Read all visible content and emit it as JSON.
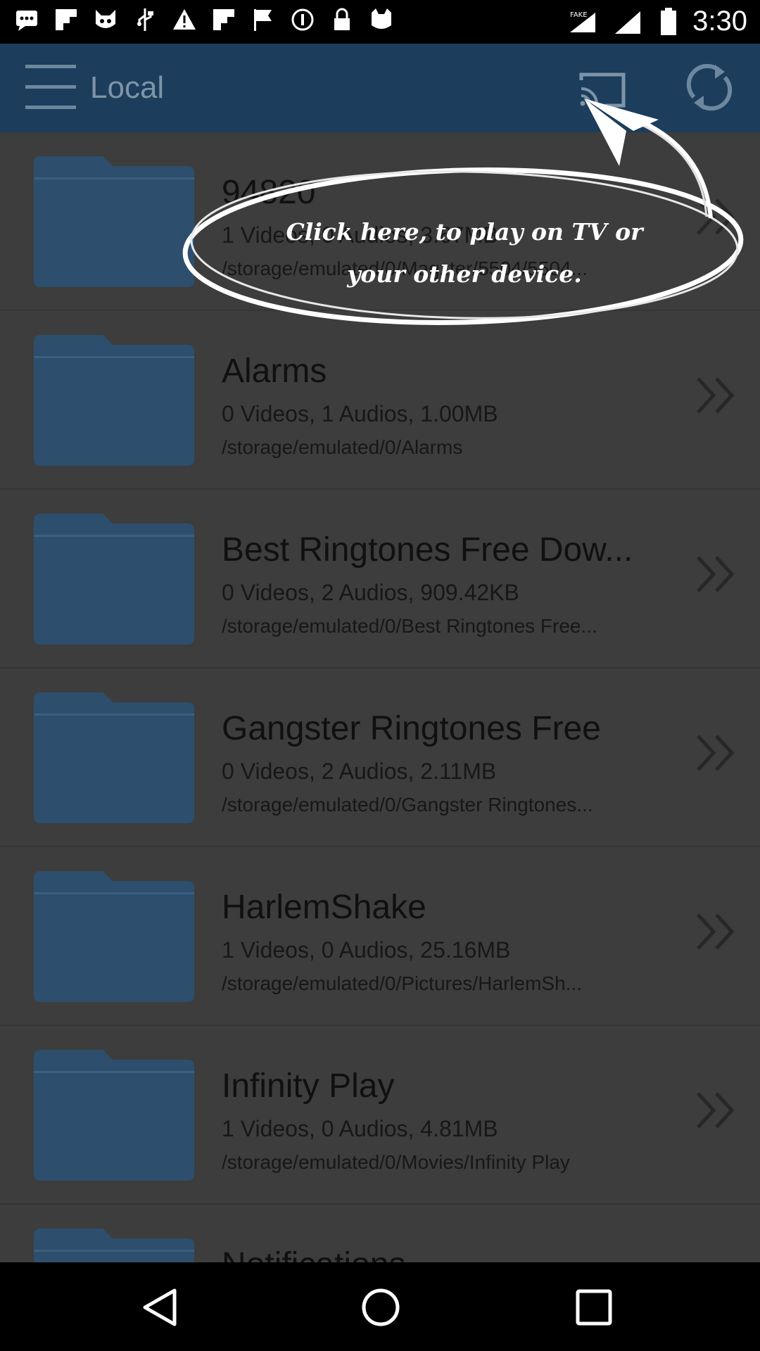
{
  "status_bar": {
    "time": "3:30",
    "icons": [
      "message-icon",
      "flipboard-icon",
      "cat-face-icon",
      "usb-icon",
      "warning-icon",
      "flipboard-icon",
      "flag-icon",
      "circle-icon",
      "lock-icon",
      "cat-icon"
    ]
  },
  "app_bar": {
    "title": "Local"
  },
  "coach_mark": {
    "text_line1": "Click here, to play on TV or",
    "text_line2": "your other device."
  },
  "folders": [
    {
      "title": "94820",
      "stats": "1 Videos, 0 Audios, 3.67MB",
      "path": "/storage/emulated/0/Magzter/5504/5504..."
    },
    {
      "title": "Alarms",
      "stats": "0 Videos, 1 Audios, 1.00MB",
      "path": "/storage/emulated/0/Alarms"
    },
    {
      "title": "Best Ringtones Free Dow...",
      "stats": "0 Videos, 2 Audios, 909.42KB",
      "path": "/storage/emulated/0/Best Ringtones Free..."
    },
    {
      "title": "Gangster Ringtones Free",
      "stats": "0 Videos, 2 Audios, 2.11MB",
      "path": "/storage/emulated/0/Gangster Ringtones..."
    },
    {
      "title": "HarlemShake",
      "stats": "1 Videos, 0 Audios, 25.16MB",
      "path": "/storage/emulated/0/Pictures/HarlemSh..."
    },
    {
      "title": "Infinity Play",
      "stats": "1 Videos, 0 Audios, 4.81MB",
      "path": "/storage/emulated/0/Movies/Infinity Play"
    },
    {
      "title": "Notifications",
      "stats": "",
      "path": ""
    }
  ],
  "colors": {
    "app_bar": "#1c3d5b",
    "folder": "#2d4f6d",
    "dim_background": "#3d3d3d"
  }
}
